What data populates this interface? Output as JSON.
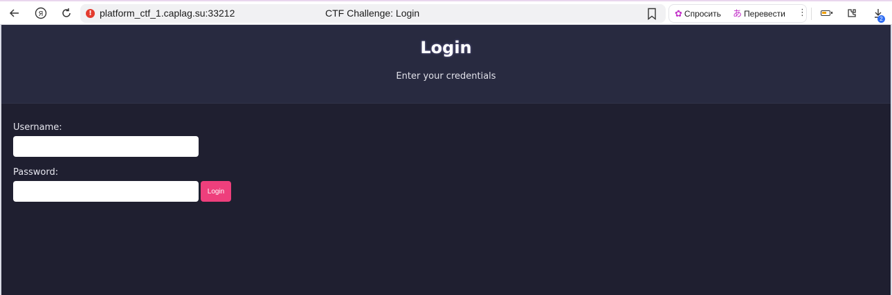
{
  "browser": {
    "url": "platform_ctf_1.caplag.su:33212",
    "tab_title": "CTF Challenge: Login",
    "ask_label": "Спросить",
    "translate_label": "Перевести",
    "more_label": "⋮",
    "downloads_count": "2",
    "icons": [
      "back-icon",
      "yandex-logo-icon",
      "reload-icon",
      "security-warning-icon",
      "bookmark-icon",
      "ask-ai-icon",
      "translate-icon",
      "battery-icon",
      "extensions-icon",
      "downloads-icon"
    ],
    "colors": {
      "warning": "#e33b2e",
      "accent_pink": "#c230c8",
      "badge": "#2f6df3"
    }
  },
  "page": {
    "title": "Login",
    "subtitle": "Enter your credentials",
    "form": {
      "username_label": "Username:",
      "username_value": "",
      "password_label": "Password:",
      "password_value": "",
      "submit_label": "Login"
    },
    "colors": {
      "background": "#1f1f30",
      "header": "#282a40",
      "button": "#ee3f7c"
    }
  }
}
